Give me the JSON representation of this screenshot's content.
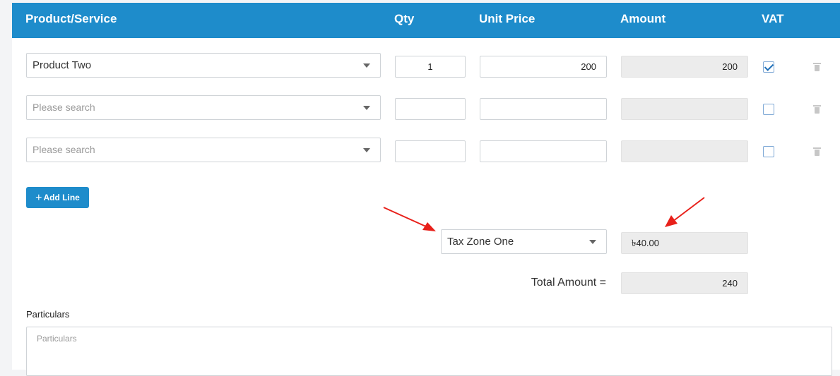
{
  "table": {
    "columns": {
      "product": "Product/Service",
      "qty": "Qty",
      "unit_price": "Unit Price",
      "amount": "Amount",
      "vat": "VAT"
    },
    "rows": [
      {
        "product": "Product Two",
        "product_placeholder": "",
        "qty": "1",
        "unit_price": "200",
        "amount": "200",
        "vat_checked": true
      },
      {
        "product": "",
        "product_placeholder": "Please search",
        "qty": "",
        "unit_price": "",
        "amount": "",
        "vat_checked": false
      },
      {
        "product": "",
        "product_placeholder": "Please search",
        "qty": "",
        "unit_price": "",
        "amount": "",
        "vat_checked": false
      }
    ]
  },
  "add_line": {
    "label": "Add Line",
    "icon": "plus-icon"
  },
  "tax": {
    "zone": "Tax Zone One",
    "amount": "৳40.00"
  },
  "total": {
    "label": "Total Amount =",
    "value": "240"
  },
  "particulars": {
    "label": "Particulars",
    "placeholder": "Particulars"
  },
  "colors": {
    "header": "#1e8ccb",
    "button": "#1e8ccb",
    "annotation_arrow": "#e8201a"
  }
}
